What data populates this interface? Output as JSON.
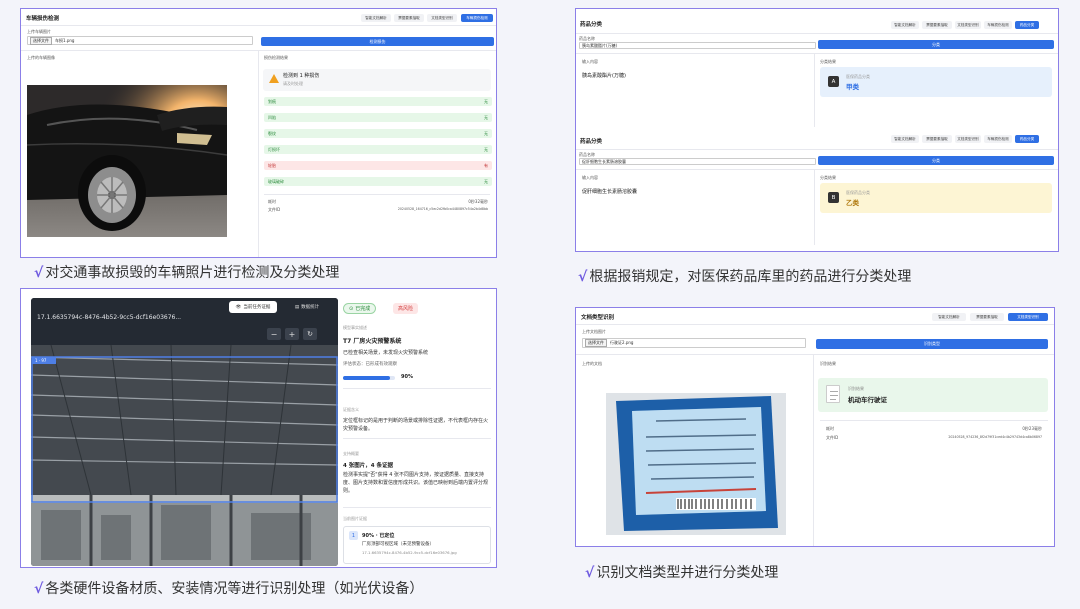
{
  "panel1": {
    "title": "车辆损伤检测",
    "tabs": [
      "智能文档解析",
      "票据要素抽取",
      "文档类型识别",
      "车辆损伤检测"
    ],
    "upload_label": "上传车辆图片",
    "choose_btn": "选择文件",
    "file_name": "车损1.png",
    "action_btn": "检测损伤",
    "left_header": "上传的车辆图像",
    "right_header": "损伤检测结果",
    "alert_title": "检测到 1 种损伤",
    "alert_sub": "请及时处理",
    "rows": [
      {
        "label": "划痕",
        "value": "无",
        "status": "ok"
      },
      {
        "label": "凹陷",
        "value": "无",
        "status": "ok"
      },
      {
        "label": "裂纹",
        "value": "无",
        "status": "ok"
      },
      {
        "label": "灯损坏",
        "value": "无",
        "status": "ok"
      },
      {
        "label": "轮胎",
        "value": "有",
        "status": "bad"
      },
      {
        "label": "玻璃破碎",
        "value": "无",
        "status": "ok"
      }
    ],
    "time_label": "耗时",
    "time_value": "0秒32毫秒",
    "file_label": "文件ID",
    "file_value": "20240528_164716_c5ec2d2fb0ca4480897c54a2b4d8bb"
  },
  "caption1": "对交通事故损毁的车辆照片进行检测及分类处理",
  "panel2": {
    "blocks": [
      {
        "title": "药品分类",
        "tabs": [
          "智能文档解析",
          "票据要素抽取",
          "文档类型识别",
          "车辆损伤检测",
          "药品分类"
        ],
        "input_label": "药品名称",
        "input_value": "胰岛素酸酯片(万糖)",
        "btn": "分类",
        "left_header": "输入内容",
        "left_text": "胰岛素酸酯片(万糖)",
        "right_header": "分类结果",
        "result_label": "医保药品分类",
        "result_value": "甲类",
        "letter": "A"
      },
      {
        "title": "药品分类",
        "tabs": [
          "智能文档解析",
          "票据要素抽取",
          "文档类型识别",
          "车辆损伤检测",
          "药品分类"
        ],
        "input_label": "药品名称",
        "input_value": "促肝细胞生长素肠溶胶囊",
        "btn": "分类",
        "left_header": "输入内容",
        "left_text": "促肝细胞生长素肠溶胶囊",
        "right_header": "分类结果",
        "result_label": "医保药品分类",
        "result_value": "乙类",
        "letter": "B"
      }
    ]
  },
  "caption2": "根据报销规定，对医保药品库里的药品进行分类处理",
  "panel3": {
    "filename": "17.1.6635794c-8476-4b52-9cc5-dcf16e03676...",
    "tabs": [
      "当前任务证据",
      "数据统计"
    ],
    "box_label": "1 · 97",
    "badge_ok": "已完成",
    "badge_risk": "高风险",
    "sec1_label": "模型事实描述",
    "sec1_title": "T7 厂房火灾预警系统",
    "sec1_text": "已检查相关场景，未发现火灾预警系统",
    "eval_text": "评估状态：已形成有效观察",
    "progress": 90,
    "progress_text": "90%",
    "sec2_label": "证据含义",
    "sec2_text": "定位框标记的是用于判断的场景或排除性证据，不代表框内存在火灾预警设备。",
    "sec3_label": "支持概要",
    "sec3_title": "4 张图片，4 条证据",
    "sec3_text": "检测事实提\"否\"获得 4 张不同图片支持，按证据质量、直接支持度、图片支持数和置信度形成共识。该值已映射到后端内置评分规则。",
    "sec4_label": "当前图片证据",
    "card_num": "1",
    "card_line1": "90% · 已定位",
    "card_line2": "厂房顶部可视区域（未见预警设备）",
    "card_line3": "17.1.6635794c-8476-4b52-9cc5-dcf16e03676.jpg"
  },
  "caption3": "各类硬件设备材质、安装情况等进行识别处理（如光伏设备）",
  "panel4": {
    "title": "文档类型识别",
    "tabs": [
      "智能文档解析",
      "票据要素抽取",
      "文档类型识别"
    ],
    "upload_label": "上传文档图片",
    "choose_btn": "选择文件",
    "file_name": "行驶证2.png",
    "action_btn": "识别类型",
    "left_header": "上传的文档",
    "right_header": "识别结果",
    "result_label": "识别结果",
    "result_value": "机动车行驶证",
    "time_label": "耗时",
    "time_value": "0秒23毫秒",
    "file_label": "文件ID",
    "file_value": "20240528_974236_8f2d79f31ced4c4b29743d4ca8b06897"
  },
  "caption4": "识别文档类型并进行分类处理",
  "colors": {
    "accent": "#2f6fe4",
    "border": "#8b7fe8",
    "check": "#6f5be0"
  }
}
